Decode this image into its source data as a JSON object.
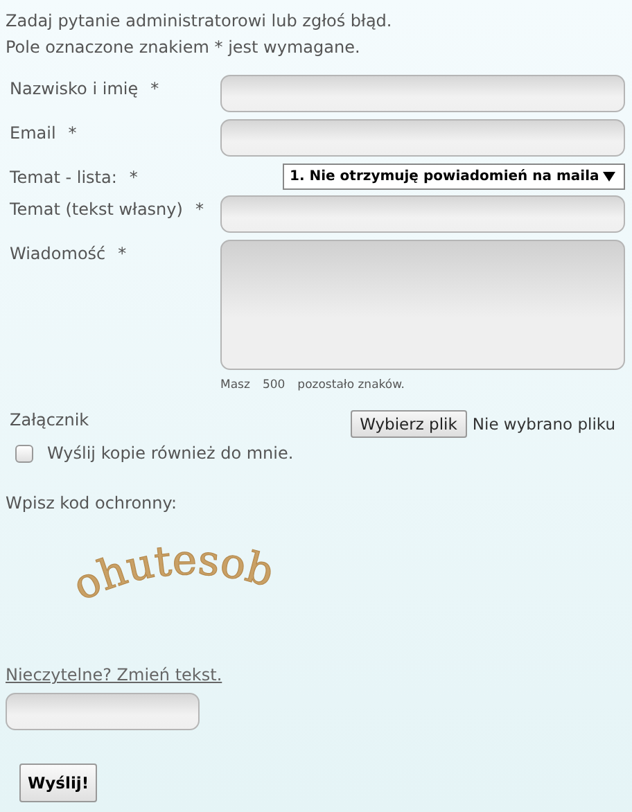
{
  "intro": [
    "Zadaj pytanie administratorowi lub zgłoś błąd.",
    "Pole oznaczone znakiem * jest wymagane."
  ],
  "fields": [
    {
      "kind": "text",
      "label": "Nazwisko i imię",
      "required_mark": "*"
    },
    {
      "kind": "text",
      "label": "Email",
      "required_mark": "*"
    },
    {
      "kind": "select",
      "label": "Temat - lista:",
      "required_mark": "*",
      "value": "1. Nie otrzymuję powiadomień na maila"
    },
    {
      "kind": "text",
      "label": "Temat (tekst własny)",
      "required_mark": "*"
    },
    {
      "kind": "textarea",
      "label": "Wiadomość",
      "required_mark": "*"
    }
  ],
  "counter": {
    "before": "Masz",
    "count": "500",
    "after": "pozostało znaków."
  },
  "attachment": {
    "label": "Załącznik",
    "button": "Wybierz plik",
    "status": "Nie wybrano pliku"
  },
  "copy_checkbox": {
    "label": "Wyślij kopie również do mnie.",
    "checked": false
  },
  "captcha": {
    "prompt": "Wpisz kod ochronny:",
    "code": "ohutesob",
    "refresh_link": "Nieczytelne? Zmień tekst."
  },
  "submit": "Wyślij!"
}
